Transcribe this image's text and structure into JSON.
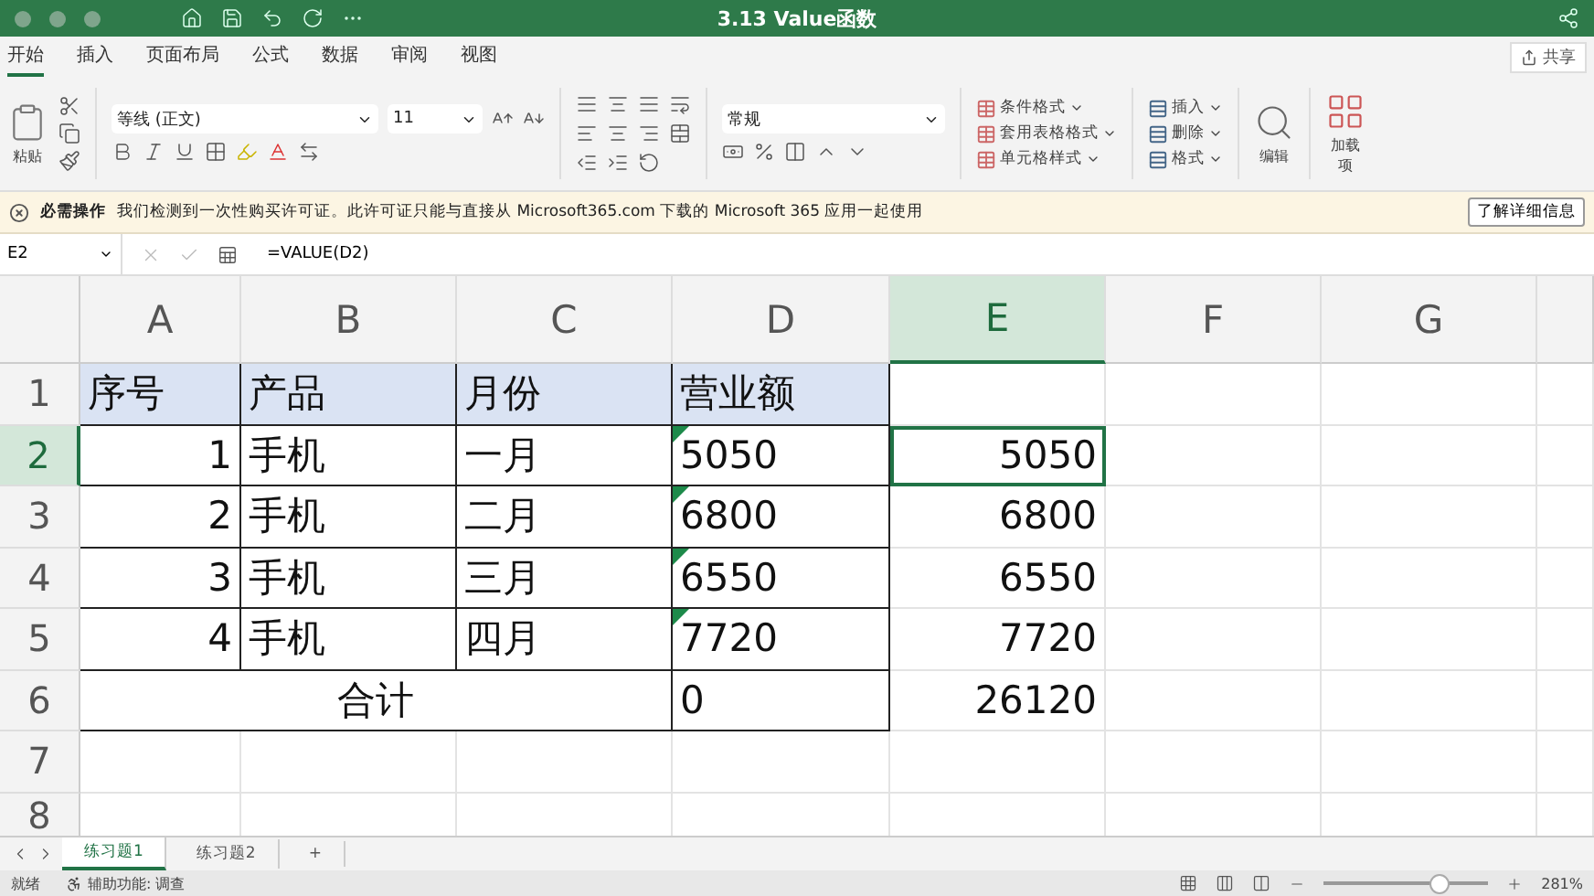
{
  "title_bar": {
    "title": "3.13 Value函数"
  },
  "menu_tabs": [
    {
      "label": "开始",
      "selected": true
    },
    {
      "label": "插入",
      "selected": false
    },
    {
      "label": "页面布局",
      "selected": false
    },
    {
      "label": "公式",
      "selected": false
    },
    {
      "label": "数据",
      "selected": false
    },
    {
      "label": "审阅",
      "selected": false
    },
    {
      "label": "视图",
      "selected": false
    }
  ],
  "share_button": "共享",
  "ribbon": {
    "paste": "粘贴",
    "font_name": "等线 (正文)",
    "font_size": "11",
    "number_format": "常规",
    "styles": [
      "条件格式",
      "套用表格格式",
      "单元格样式"
    ],
    "cells": [
      "插入",
      "删除",
      "格式"
    ],
    "edit": "编辑",
    "addins": "加载项"
  },
  "notice": {
    "title": "必需操作",
    "message": "我们检测到一次性购买许可证。此许可证只能与直接从 Microsoft365.com 下载的 Microsoft 365 应用一起使用",
    "button": "了解详细信息"
  },
  "formula_bar": {
    "cell_ref": "E2",
    "formula": "=VALUE(D2)"
  },
  "sheet": {
    "columns": [
      {
        "label": "A",
        "selected": false
      },
      {
        "label": "B",
        "selected": false
      },
      {
        "label": "C",
        "selected": false
      },
      {
        "label": "D",
        "selected": false
      },
      {
        "label": "E",
        "selected": true
      },
      {
        "label": "F",
        "selected": false
      },
      {
        "label": "G",
        "selected": false
      }
    ],
    "rows": [
      {
        "number": "1",
        "selected": false,
        "kind": "header",
        "cells": [
          "序号",
          "产品",
          "月份",
          "营业额"
        ]
      },
      {
        "number": "2",
        "selected": true,
        "kind": "data",
        "no": "1",
        "product": "手机",
        "month": "一月",
        "revenue": "5050",
        "flagged": true,
        "value": "5050"
      },
      {
        "number": "3",
        "selected": false,
        "kind": "data",
        "no": "2",
        "product": "手机",
        "month": "二月",
        "revenue": "6800",
        "flagged": true,
        "value": "6800"
      },
      {
        "number": "4",
        "selected": false,
        "kind": "data",
        "no": "3",
        "product": "手机",
        "month": "三月",
        "revenue": "6550",
        "flagged": true,
        "value": "6550"
      },
      {
        "number": "5",
        "selected": false,
        "kind": "data",
        "no": "4",
        "product": "手机",
        "month": "四月",
        "revenue": "7720",
        "flagged": true,
        "value": "7720"
      },
      {
        "number": "6",
        "selected": false,
        "kind": "total",
        "label": "合计",
        "revenue": "0",
        "value": "26120"
      },
      {
        "number": "7",
        "selected": false,
        "kind": "empty"
      },
      {
        "number": "8",
        "selected": false,
        "kind": "empty"
      }
    ]
  },
  "sheet_tabs": [
    {
      "label": "练习题1",
      "selected": true
    },
    {
      "label": "练习题2",
      "selected": false
    }
  ],
  "add_sheet": "+",
  "status_bar": {
    "ready": "就绪",
    "accessibility": "辅助功能: 调查",
    "zoom": "281%",
    "zoom_slider": {
      "level": 0.72
    }
  }
}
